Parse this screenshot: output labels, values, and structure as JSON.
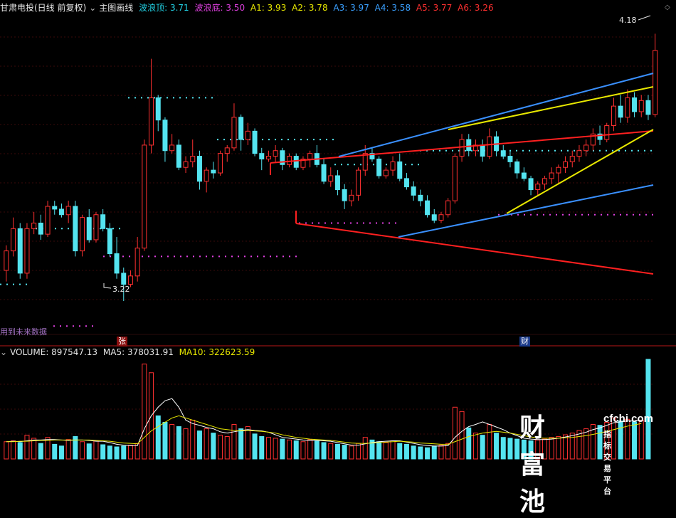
{
  "header": {
    "stock_title": "甘肃电投(日线 前复权)",
    "chevron": "⌄",
    "indicator_name": "主图画线",
    "items": [
      {
        "label": "波浪顶: 3.71",
        "color": "#22d3e6"
      },
      {
        "label": "波浪底: 3.50",
        "color": "#e040e0"
      },
      {
        "label": "A1: 3.93",
        "color": "#e8e800"
      },
      {
        "label": "A2: 3.78",
        "color": "#e8e800"
      },
      {
        "label": "A3: 3.97",
        "color": "#3aa0ff"
      },
      {
        "label": "A4: 3.58",
        "color": "#3aa0ff"
      },
      {
        "label": "A5: 3.77",
        "color": "#ff3030"
      },
      {
        "label": "A6: 3.26",
        "color": "#ff3030"
      }
    ]
  },
  "volume_header": {
    "name": "VOLUME: 897547.13",
    "ma5": "MA5: 378031.91",
    "ma10": "MA10: 322623.59",
    "ma5_color": "#ffffff",
    "ma10_color": "#e8e800"
  },
  "annotations": {
    "high_label": "4.18",
    "low_label": "3.22",
    "future_label": "用到未来数据",
    "marker_zhang": "张",
    "marker_cai": "财"
  },
  "watermark": {
    "cn": "财富池",
    "en": "cfchi.com",
    "sub": "指标交易平台"
  },
  "colors": {
    "up": "#ff3030",
    "down": "#54e4f0",
    "dots_top": "#54e4f0",
    "dots_bottom": "#e040e0",
    "yellow": "#e8e800",
    "blue": "#3a90ff",
    "red": "#ff2020"
  },
  "chart_data": {
    "type": "candlestick",
    "price_range": [
      3.1,
      4.25
    ],
    "candles": [
      [
        3.33,
        3.42,
        3.29,
        3.4
      ],
      [
        3.4,
        3.52,
        3.38,
        3.48
      ],
      [
        3.48,
        3.5,
        3.3,
        3.32
      ],
      [
        3.32,
        3.5,
        3.3,
        3.48
      ],
      [
        3.48,
        3.54,
        3.46,
        3.5
      ],
      [
        3.5,
        3.53,
        3.44,
        3.46
      ],
      [
        3.46,
        3.58,
        3.45,
        3.56
      ],
      [
        3.56,
        3.58,
        3.53,
        3.55
      ],
      [
        3.55,
        3.57,
        3.52,
        3.53
      ],
      [
        3.53,
        3.58,
        3.5,
        3.56
      ],
      [
        3.56,
        3.58,
        3.38,
        3.4
      ],
      [
        3.4,
        3.53,
        3.38,
        3.52
      ],
      [
        3.52,
        3.55,
        3.43,
        3.44
      ],
      [
        3.44,
        3.54,
        3.43,
        3.53
      ],
      [
        3.53,
        3.55,
        3.47,
        3.48
      ],
      [
        3.48,
        3.5,
        3.38,
        3.39
      ],
      [
        3.39,
        3.45,
        3.3,
        3.32
      ],
      [
        3.32,
        3.34,
        3.22,
        3.28
      ],
      [
        3.28,
        3.33,
        3.27,
        3.31
      ],
      [
        3.31,
        3.45,
        3.29,
        3.41
      ],
      [
        3.41,
        3.8,
        3.4,
        3.78
      ],
      [
        3.78,
        4.09,
        3.75,
        3.95
      ],
      [
        3.95,
        3.96,
        3.83,
        3.87
      ],
      [
        3.87,
        3.88,
        3.72,
        3.76
      ],
      [
        3.76,
        3.82,
        3.75,
        3.78
      ],
      [
        3.78,
        3.8,
        3.69,
        3.7
      ],
      [
        3.7,
        3.74,
        3.68,
        3.72
      ],
      [
        3.72,
        3.8,
        3.7,
        3.74
      ],
      [
        3.74,
        3.76,
        3.62,
        3.65
      ],
      [
        3.65,
        3.7,
        3.61,
        3.69
      ],
      [
        3.69,
        3.72,
        3.66,
        3.68
      ],
      [
        3.68,
        3.76,
        3.67,
        3.75
      ],
      [
        3.75,
        3.78,
        3.72,
        3.77
      ],
      [
        3.77,
        3.93,
        3.76,
        3.88
      ],
      [
        3.88,
        3.89,
        3.76,
        3.8
      ],
      [
        3.8,
        3.86,
        3.78,
        3.83
      ],
      [
        3.83,
        3.84,
        3.74,
        3.75
      ],
      [
        3.75,
        3.77,
        3.69,
        3.73
      ],
      [
        3.73,
        3.76,
        3.72,
        3.74
      ],
      [
        3.74,
        3.78,
        3.72,
        3.76
      ],
      [
        3.76,
        3.77,
        3.69,
        3.71
      ],
      [
        3.71,
        3.75,
        3.7,
        3.74
      ],
      [
        3.74,
        3.75,
        3.69,
        3.7
      ],
      [
        3.7,
        3.74,
        3.69,
        3.73
      ],
      [
        3.73,
        3.76,
        3.7,
        3.75
      ],
      [
        3.75,
        3.78,
        3.7,
        3.71
      ],
      [
        3.71,
        3.73,
        3.64,
        3.65
      ],
      [
        3.65,
        3.7,
        3.63,
        3.67
      ],
      [
        3.67,
        3.69,
        3.6,
        3.62
      ],
      [
        3.62,
        3.64,
        3.55,
        3.58
      ],
      [
        3.58,
        3.62,
        3.56,
        3.6
      ],
      [
        3.6,
        3.7,
        3.58,
        3.69
      ],
      [
        3.69,
        3.78,
        3.67,
        3.75
      ],
      [
        3.75,
        3.77,
        3.72,
        3.73
      ],
      [
        3.73,
        3.74,
        3.66,
        3.67
      ],
      [
        3.67,
        3.7,
        3.66,
        3.69
      ],
      [
        3.69,
        3.74,
        3.67,
        3.72
      ],
      [
        3.72,
        3.75,
        3.65,
        3.66
      ],
      [
        3.66,
        3.68,
        3.62,
        3.63
      ],
      [
        3.63,
        3.65,
        3.58,
        3.6
      ],
      [
        3.6,
        3.62,
        3.56,
        3.58
      ],
      [
        3.58,
        3.6,
        3.52,
        3.53
      ],
      [
        3.53,
        3.55,
        3.5,
        3.51
      ],
      [
        3.51,
        3.54,
        3.5,
        3.53
      ],
      [
        3.53,
        3.59,
        3.52,
        3.58
      ],
      [
        3.58,
        3.75,
        3.57,
        3.74
      ],
      [
        3.74,
        3.82,
        3.72,
        3.8
      ],
      [
        3.8,
        3.82,
        3.74,
        3.76
      ],
      [
        3.76,
        3.8,
        3.74,
        3.78
      ],
      [
        3.78,
        3.8,
        3.72,
        3.74
      ],
      [
        3.74,
        3.84,
        3.73,
        3.81
      ],
      [
        3.81,
        3.83,
        3.74,
        3.76
      ],
      [
        3.76,
        3.78,
        3.73,
        3.74
      ],
      [
        3.74,
        3.76,
        3.7,
        3.72
      ],
      [
        3.72,
        3.73,
        3.66,
        3.68
      ],
      [
        3.68,
        3.7,
        3.65,
        3.66
      ],
      [
        3.66,
        3.67,
        3.6,
        3.62
      ],
      [
        3.62,
        3.65,
        3.6,
        3.64
      ],
      [
        3.64,
        3.67,
        3.62,
        3.66
      ],
      [
        3.66,
        3.7,
        3.64,
        3.68
      ],
      [
        3.68,
        3.71,
        3.64,
        3.7
      ],
      [
        3.7,
        3.74,
        3.68,
        3.72
      ],
      [
        3.72,
        3.76,
        3.7,
        3.74
      ],
      [
        3.74,
        3.78,
        3.72,
        3.76
      ],
      [
        3.76,
        3.8,
        3.74,
        3.78
      ],
      [
        3.78,
        3.84,
        3.76,
        3.82
      ],
      [
        3.82,
        3.85,
        3.78,
        3.8
      ],
      [
        3.8,
        3.86,
        3.79,
        3.85
      ],
      [
        3.85,
        3.95,
        3.83,
        3.92
      ],
      [
        3.92,
        3.96,
        3.86,
        3.88
      ],
      [
        3.88,
        3.98,
        3.86,
        3.95
      ],
      [
        3.95,
        3.97,
        3.88,
        3.9
      ],
      [
        3.9,
        3.96,
        3.88,
        3.94
      ],
      [
        3.94,
        3.96,
        3.87,
        3.89
      ],
      [
        3.89,
        4.18,
        3.88,
        4.12
      ]
    ],
    "volume": [
      40,
      42,
      38,
      55,
      48,
      36,
      50,
      34,
      30,
      45,
      52,
      40,
      35,
      42,
      33,
      30,
      28,
      30,
      32,
      36,
      220,
      200,
      100,
      85,
      80,
      75,
      70,
      90,
      65,
      70,
      60,
      55,
      52,
      80,
      70,
      75,
      58,
      52,
      50,
      48,
      46,
      44,
      42,
      40,
      45,
      42,
      38,
      36,
      34,
      32,
      30,
      36,
      50,
      44,
      40,
      38,
      42,
      36,
      34,
      30,
      28,
      26,
      30,
      32,
      36,
      120,
      110,
      72,
      60,
      55,
      80,
      60,
      50,
      48,
      46,
      44,
      42,
      44,
      46,
      50,
      52,
      56,
      60,
      66,
      70,
      80,
      78,
      85,
      95,
      88,
      92,
      86,
      90,
      900
    ],
    "ma5": [
      40,
      41,
      40,
      42,
      44,
      44,
      45,
      45,
      44,
      43,
      44,
      44,
      43,
      41,
      41,
      38,
      34,
      32,
      31,
      31,
      70,
      100,
      120,
      135,
      140,
      120,
      90,
      82,
      78,
      73,
      70,
      63,
      60,
      63,
      66,
      68,
      66,
      65,
      62,
      56,
      50,
      48,
      46,
      44,
      43,
      43,
      42,
      41,
      38,
      35,
      32,
      32,
      35,
      38,
      40,
      41,
      42,
      42,
      39,
      36,
      33,
      31,
      30,
      30,
      31,
      50,
      64,
      75,
      80,
      86,
      80,
      74,
      68,
      60,
      54,
      48,
      46,
      45,
      45,
      46,
      48,
      51,
      54,
      58,
      62,
      68,
      72,
      78,
      84,
      86,
      88,
      88,
      90,
      378
    ],
    "ma10": [
      40,
      40,
      41,
      41,
      42,
      43,
      43,
      44,
      44,
      44,
      44,
      44,
      44,
      43,
      42,
      41,
      39,
      37,
      36,
      35,
      50,
      65,
      75,
      85,
      95,
      100,
      95,
      90,
      85,
      80,
      75,
      70,
      68,
      66,
      65,
      66,
      65,
      64,
      62,
      60,
      56,
      53,
      50,
      48,
      46,
      45,
      44,
      43,
      41,
      39,
      37,
      36,
      36,
      37,
      38,
      39,
      40,
      41,
      40,
      39,
      37,
      36,
      35,
      34,
      34,
      40,
      46,
      52,
      56,
      60,
      62,
      64,
      62,
      60,
      57,
      54,
      51,
      49,
      48,
      48,
      48,
      49,
      50,
      52,
      54,
      57,
      60,
      64,
      68,
      72,
      76,
      79,
      82,
      323
    ]
  }
}
